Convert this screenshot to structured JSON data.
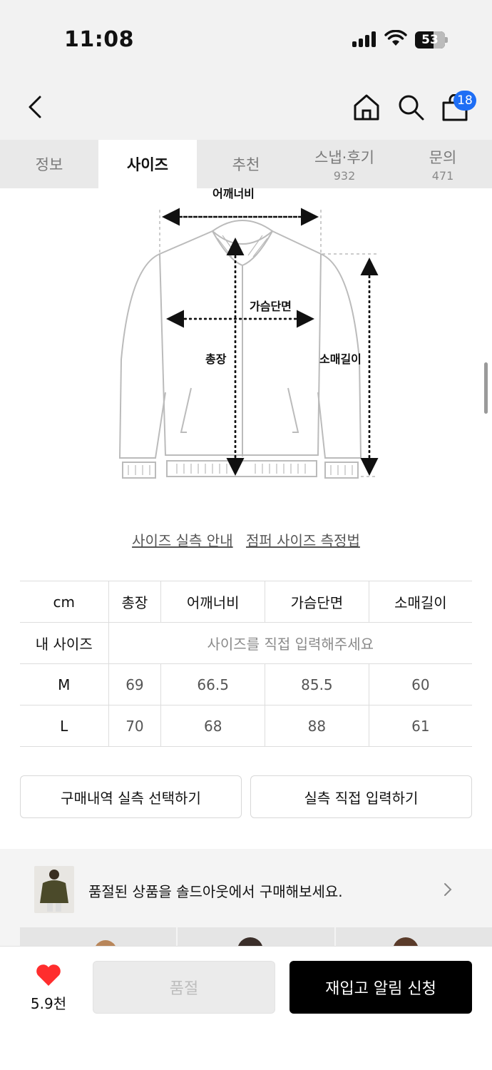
{
  "status_bar": {
    "time": "11:08",
    "battery": "53"
  },
  "header": {
    "cart_count": "18",
    "back_icon": "chevron-left-icon",
    "home_icon": "home-icon",
    "search_icon": "search-icon",
    "cart_icon": "shopping-bag-icon"
  },
  "tabs": [
    {
      "label": "정보",
      "count": ""
    },
    {
      "label": "사이즈",
      "count": ""
    },
    {
      "label": "추천",
      "count": ""
    },
    {
      "label": "스냅·후기",
      "count": "932"
    },
    {
      "label": "문의",
      "count": "471"
    }
  ],
  "diagram": {
    "shoulder": "어깨너비",
    "chest": "가슴단면",
    "length": "총장",
    "sleeve": "소매길이"
  },
  "guides": {
    "measure": "사이즈 실측 안내",
    "method": "점퍼 사이즈 측정법"
  },
  "size_table": {
    "headers": [
      "cm",
      "총장",
      "어깨너비",
      "가슴단면",
      "소매길이"
    ],
    "my_size": {
      "label": "내 사이즈",
      "placeholder": "사이즈를 직접 입력해주세요"
    },
    "rows": [
      {
        "size": "M",
        "values": [
          "69",
          "66.5",
          "85.5",
          "60"
        ]
      },
      {
        "size": "L",
        "values": [
          "70",
          "68",
          "88",
          "61"
        ]
      }
    ]
  },
  "actions": {
    "select_history": "구매내역 실측 선택하기",
    "manual_input": "실측 직접 입력하기"
  },
  "promo": {
    "text": "품절된 상품을 솔드아웃에서 구매해보세요."
  },
  "bottom": {
    "like_count": "5.9천",
    "soldout": "품절",
    "restock": "재입고 알림 신청"
  },
  "colors": {
    "accent_blue": "#1e6ef5",
    "heart_red": "#ff2d2d",
    "primary_black": "#000000"
  }
}
